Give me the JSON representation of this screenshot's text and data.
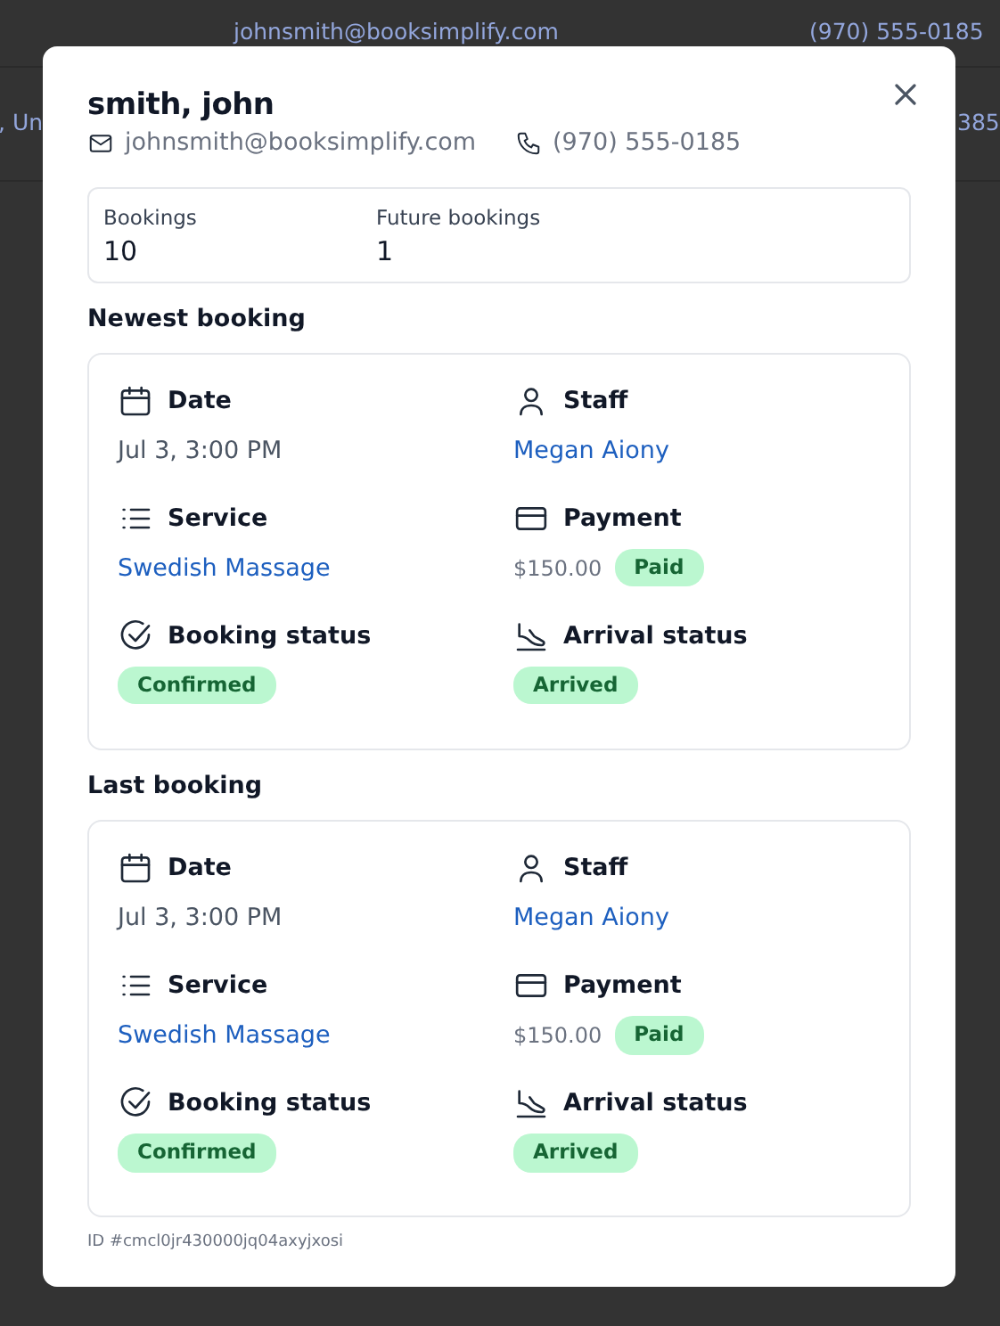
{
  "background_rows": [
    {
      "email": "johnsmith@booksimplify.com",
      "phone": "(970) 555-0185"
    },
    {
      "email": ", Un",
      "phone": "385"
    }
  ],
  "dialog": {
    "title": "smith, john",
    "email": "johnsmith@booksimplify.com",
    "phone": "(970) 555-0185",
    "stats": [
      {
        "label": "Bookings",
        "value": "10"
      },
      {
        "label": "Future bookings",
        "value": "1"
      }
    ],
    "sections": [
      {
        "title": "Newest booking",
        "fields": [
          {
            "label": "Date",
            "kind": "text",
            "value": "Jul 3, 3:00 PM"
          },
          {
            "label": "Staff",
            "kind": "link",
            "value": "Megan Aiony"
          },
          {
            "label": "Service",
            "kind": "link",
            "value": "Swedish Massage"
          },
          {
            "label": "Payment",
            "kind": "payment",
            "value": "$150.00",
            "badge": "Paid"
          },
          {
            "label": "Booking status",
            "kind": "badge",
            "badge": "Confirmed"
          },
          {
            "label": "Arrival status",
            "kind": "badge",
            "badge": "Arrived"
          }
        ]
      },
      {
        "title": "Last booking",
        "fields": [
          {
            "label": "Date",
            "kind": "text",
            "value": "Jul 3, 3:00 PM"
          },
          {
            "label": "Staff",
            "kind": "link",
            "value": "Megan Aiony"
          },
          {
            "label": "Service",
            "kind": "link",
            "value": "Swedish Massage"
          },
          {
            "label": "Payment",
            "kind": "payment",
            "value": "$150.00",
            "badge": "Paid"
          },
          {
            "label": "Booking status",
            "kind": "badge",
            "badge": "Confirmed"
          },
          {
            "label": "Arrival status",
            "kind": "badge",
            "badge": "Arrived"
          }
        ]
      }
    ],
    "footer_id": "ID #cmcl0jr430000jq04axyjxosi"
  }
}
